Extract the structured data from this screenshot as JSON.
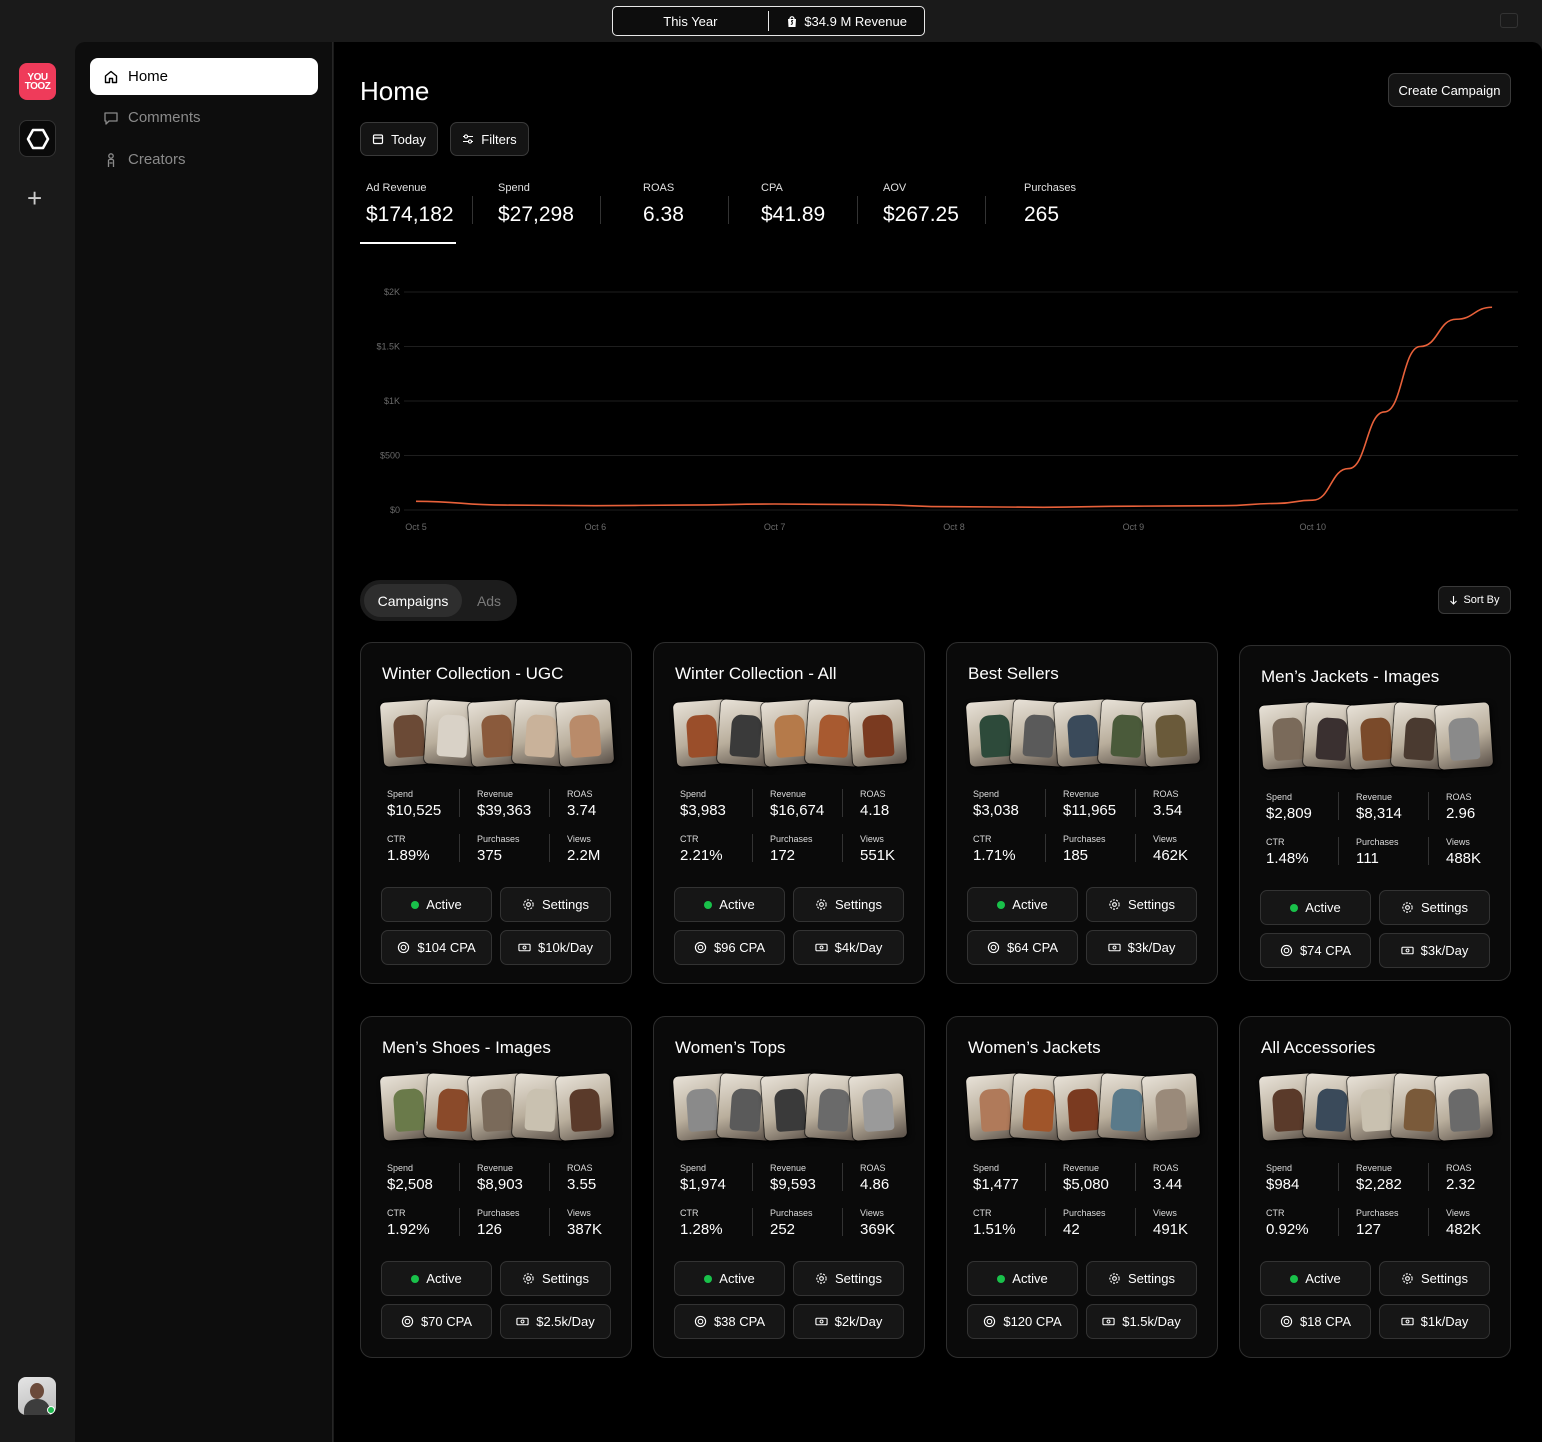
{
  "topbar": {
    "period": "This Year",
    "revenue": "$34.9 M Revenue"
  },
  "rail": {
    "logo_text_1": "YOU",
    "logo_text_2": "TOOZ"
  },
  "sidebar": {
    "items": [
      {
        "label": "Home",
        "icon": "home-icon",
        "active": true
      },
      {
        "label": "Comments",
        "icon": "comment-icon",
        "active": false
      },
      {
        "label": "Creators",
        "icon": "creator-icon",
        "active": false
      }
    ]
  },
  "header": {
    "title": "Home",
    "create_label": "Create Campaign",
    "today_label": "Today",
    "filters_label": "Filters"
  },
  "kpis": [
    {
      "label": "Ad Revenue",
      "value": "$174,182"
    },
    {
      "label": "Spend",
      "value": "$27,298"
    },
    {
      "label": "ROAS",
      "value": "6.38"
    },
    {
      "label": "CPA",
      "value": "$41.89"
    },
    {
      "label": "AOV",
      "value": "$267.25"
    },
    {
      "label": "Purchases",
      "value": "265"
    }
  ],
  "chart_data": {
    "type": "line",
    "title": "",
    "xlabel": "",
    "ylabel": "",
    "ylim": [
      0,
      2000
    ],
    "yticks": [
      {
        "value": 2000,
        "label": "$2K"
      },
      {
        "value": 1500,
        "label": "$1.5K"
      },
      {
        "value": 1000,
        "label": "$1K"
      },
      {
        "value": 500,
        "label": "$500"
      },
      {
        "value": 0,
        "label": "$0"
      }
    ],
    "xticks": [
      "Oct 5",
      "Oct 6",
      "Oct 7",
      "Oct 8",
      "Oct 9",
      "Oct 10"
    ],
    "grid": true,
    "series": [
      {
        "color": "#e8613a",
        "x": [
          0,
          0.5,
          1,
          1.5,
          2,
          2.5,
          3,
          3.5,
          4,
          4.5,
          4.8,
          5,
          5.2,
          5.4,
          5.6,
          5.8,
          6.0
        ],
        "y": [
          80,
          45,
          40,
          45,
          55,
          50,
          30,
          25,
          35,
          40,
          60,
          90,
          380,
          900,
          1500,
          1750,
          1860
        ]
      }
    ]
  },
  "tabs": {
    "campaigns": "Campaigns",
    "ads": "Ads",
    "sort": "Sort By"
  },
  "campaigns": [
    {
      "title": "Winter Collection - UGC",
      "spend": "$10,525",
      "revenue": "$39,363",
      "roas": "3.74",
      "ctr": "1.89%",
      "purchases": "375",
      "views": "2.2M",
      "status": "Active",
      "settings": "Settings",
      "cpa": "$104 CPA",
      "budget": "$10k/Day"
    },
    {
      "title": "Winter Collection - All",
      "spend": "$3,983",
      "revenue": "$16,674",
      "roas": "4.18",
      "ctr": "2.21%",
      "purchases": "172",
      "views": "551K",
      "status": "Active",
      "settings": "Settings",
      "cpa": "$96 CPA",
      "budget": "$4k/Day"
    },
    {
      "title": "Best Sellers",
      "spend": "$3,038",
      "revenue": "$11,965",
      "roas": "3.54",
      "ctr": "1.71%",
      "purchases": "185",
      "views": "462K",
      "status": "Active",
      "settings": "Settings",
      "cpa": "$64 CPA",
      "budget": "$3k/Day"
    },
    {
      "title": "Men’s Jackets - Images",
      "spend": "$2,809",
      "revenue": "$8,314",
      "roas": "2.96",
      "ctr": "1.48%",
      "purchases": "111",
      "views": "488K",
      "status": "Active",
      "settings": "Settings",
      "cpa": "$74 CPA",
      "budget": "$3k/Day"
    },
    {
      "title": "Men’s Shoes - Images",
      "spend": "$2,508",
      "revenue": "$8,903",
      "roas": "3.55",
      "ctr": "1.92%",
      "purchases": "126",
      "views": "387K",
      "status": "Active",
      "settings": "Settings",
      "cpa": "$70 CPA",
      "budget": "$2.5k/Day"
    },
    {
      "title": "Women’s Tops",
      "spend": "$1,974",
      "revenue": "$9,593",
      "roas": "4.86",
      "ctr": "1.28%",
      "purchases": "252",
      "views": "369K",
      "status": "Active",
      "settings": "Settings",
      "cpa": "$38 CPA",
      "budget": "$2k/Day"
    },
    {
      "title": "Women’s Jackets",
      "spend": "$1,477",
      "revenue": "$5,080",
      "roas": "3.44",
      "ctr": "1.51%",
      "purchases": "42",
      "views": "491K",
      "status": "Active",
      "settings": "Settings",
      "cpa": "$120 CPA",
      "budget": "$1.5k/Day"
    },
    {
      "title": "All Accessories",
      "spend": "$984",
      "revenue": "$2,282",
      "roas": "2.32",
      "ctr": "0.92%",
      "purchases": "127",
      "views": "482K",
      "status": "Active",
      "settings": "Settings",
      "cpa": "$18 CPA",
      "budget": "$1k/Day"
    }
  ],
  "stat_labels": {
    "spend": "Spend",
    "revenue": "Revenue",
    "roas": "ROAS",
    "ctr": "CTR",
    "purchases": "Purchases",
    "views": "Views"
  },
  "photo_palettes": [
    [
      "#6b4a36",
      "#d9d2c7",
      "#8a5a3c",
      "#c9b29a",
      "#b98b6a"
    ],
    [
      "#9a4e2a",
      "#3a3a3a",
      "#b57a4a",
      "#a85a30",
      "#7a3a20"
    ],
    [
      "#2d4a3a",
      "#5a5a5a",
      "#3a4a5a",
      "#4a5a3a",
      "#6a5a3a"
    ],
    [
      "#7a6a5a",
      "#3a3030",
      "#7a4a2a",
      "#4a3a30",
      "#8a8a8a"
    ],
    [
      "#6a7a4a",
      "#8a4a2a",
      "#7a6a5a",
      "#c9c1b0",
      "#5a3a2a"
    ],
    [
      "#8a8a8a",
      "#5a5a5a",
      "#3a3a3a",
      "#6a6a6a",
      "#9a9a9a"
    ],
    [
      "#b07a5a",
      "#a0552a",
      "#7a3a20",
      "#5a7a8a",
      "#9a8a7a"
    ],
    [
      "#5a3a2a",
      "#3a4a5a",
      "#c9c1b0",
      "#7a5a3a",
      "#6a6a6a"
    ]
  ]
}
